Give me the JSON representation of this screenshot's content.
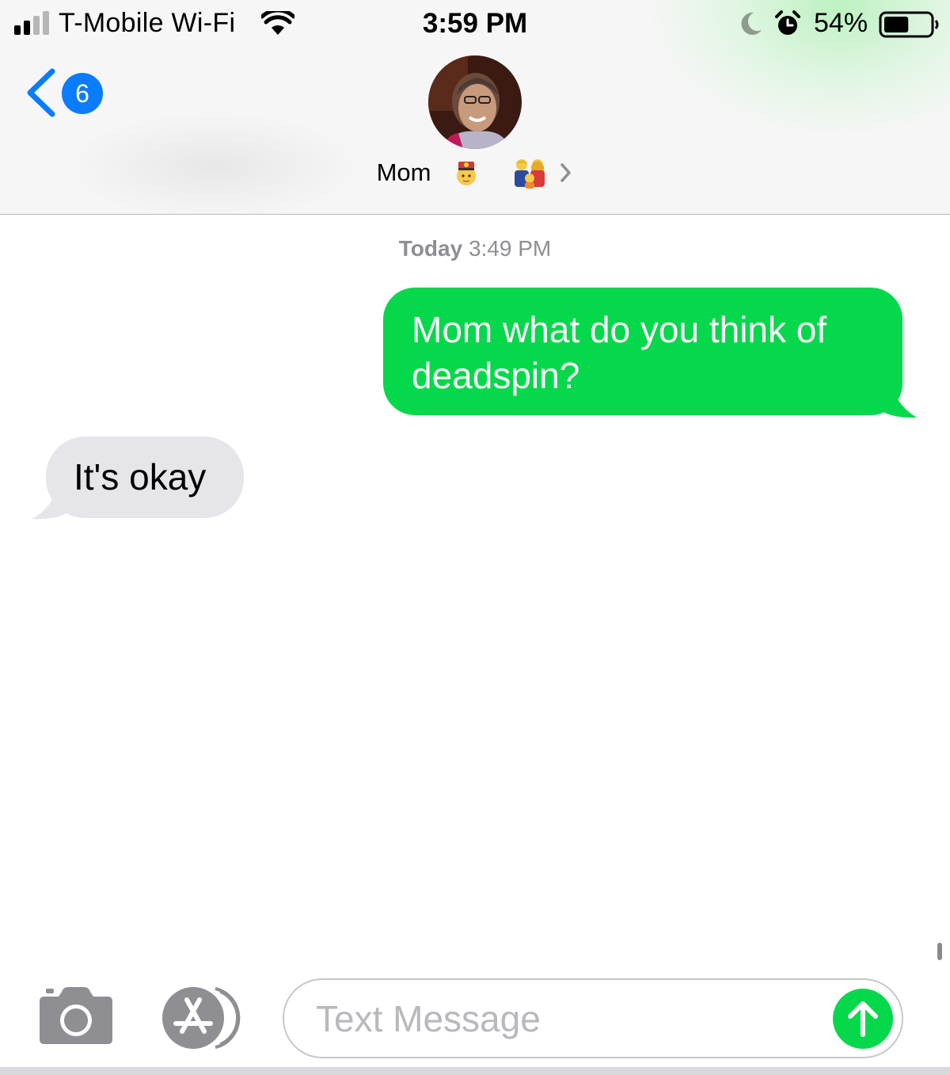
{
  "status_bar": {
    "carrier": "T-Mobile Wi-Fi",
    "time": "3:59 PM",
    "battery_percent": "54%",
    "battery_level": 0.54,
    "signal_bars_filled": 2,
    "signal_bars_total": 4,
    "icons": [
      "signal-icon",
      "wifi-icon",
      "moon-icon",
      "alarm-icon",
      "battery-icon"
    ]
  },
  "header": {
    "back_badge_count": "6",
    "contact_name": "Mom",
    "contact_emojis": [
      "person-with-crown-emoji",
      "family-emoji"
    ],
    "accent_color": "#0a7cff"
  },
  "conversation": {
    "timestamp_day": "Today",
    "timestamp_time": "3:49 PM",
    "messages": [
      {
        "direction": "outgoing",
        "text": "Mom what do you think of deadspin?",
        "color": "#05d84a"
      },
      {
        "direction": "incoming",
        "text": "It's okay",
        "color": "#e5e5ea"
      }
    ]
  },
  "input_bar": {
    "placeholder": "Text Message",
    "send_color": "#05d84a",
    "icons": [
      "camera-icon",
      "app-store-icon",
      "send-arrow-icon"
    ]
  }
}
